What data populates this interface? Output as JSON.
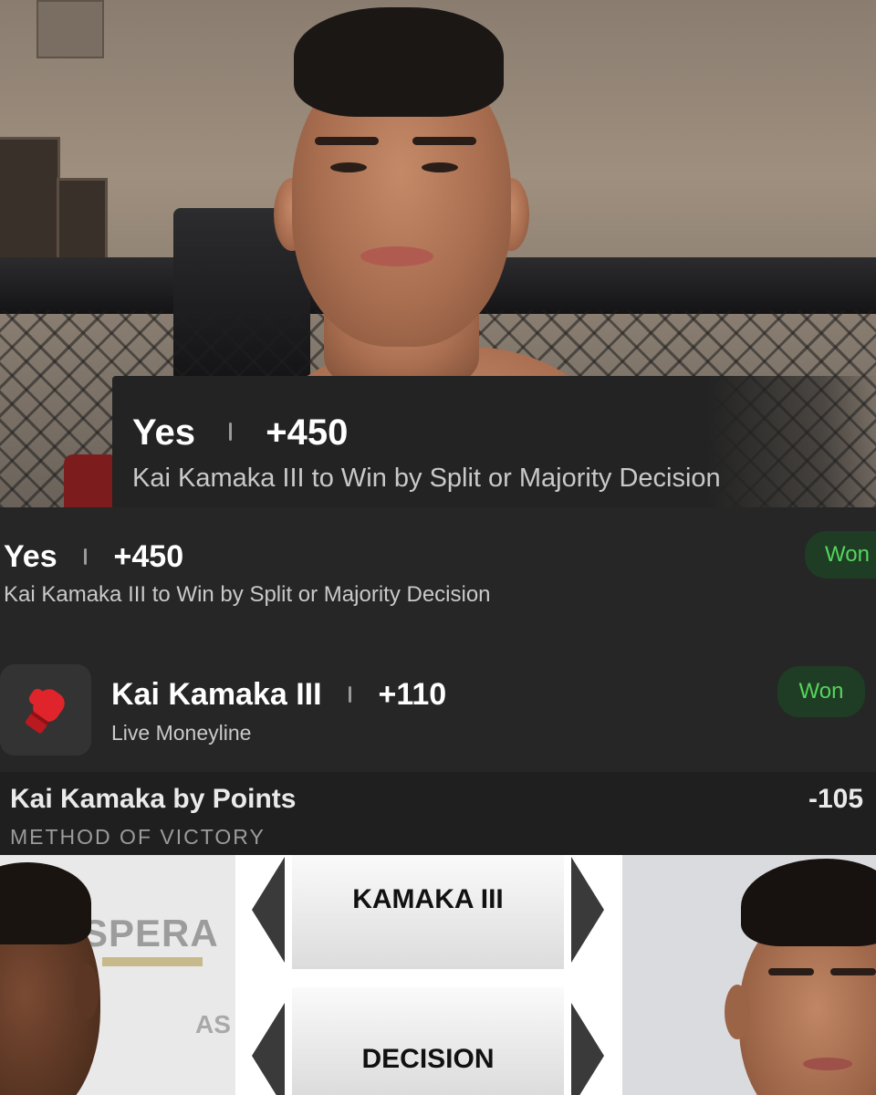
{
  "hero_card": {
    "selection": "Yes",
    "odds": "+450",
    "description": "Kai Kamaka III to Win by Split or Majority Decision"
  },
  "bet_slip_1": {
    "selection": "Yes",
    "odds": "+450",
    "description": "Kai Kamaka III to Win by Split or Majority Decision",
    "status": "Won"
  },
  "bet_slip_2": {
    "icon": "boxing-glove-icon",
    "selection": "Kai Kamaka III",
    "odds": "+110",
    "market": "Live Moneyline",
    "status": "Won"
  },
  "market_row": {
    "title": "Kai Kamaka by Points",
    "odds": "-105",
    "category": "METHOD OF VICTORY"
  },
  "collage": {
    "left_banner_text": "SPERA",
    "left_sub_text": "AS",
    "pick_tile_1": "KAMAKA III",
    "pick_tile_2": "DECISION"
  },
  "colors": {
    "won_text": "#55d45d",
    "won_bg": "#1f3d24",
    "glove_red": "#e0242b"
  }
}
